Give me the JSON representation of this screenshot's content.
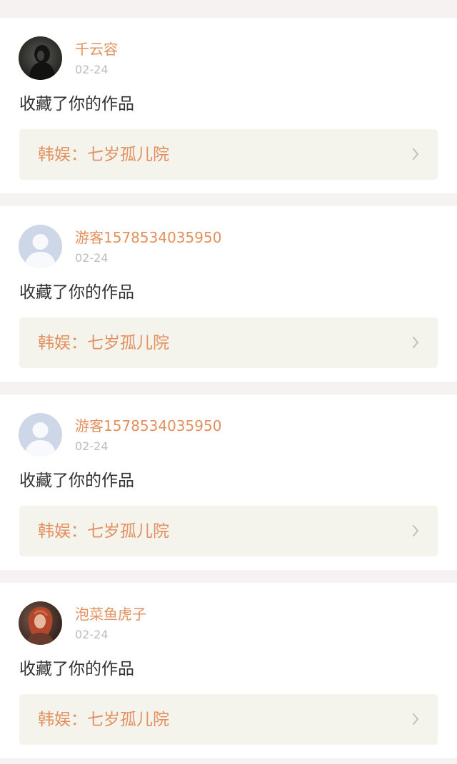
{
  "notifications": [
    {
      "username": "千云容",
      "date": "02-24",
      "action": "收藏了你的作品",
      "work_title": "韩娱：七岁孤儿院",
      "avatar": "dark-portrait"
    },
    {
      "username": "游客1578534035950",
      "date": "02-24",
      "action": "收藏了你的作品",
      "work_title": "韩娱：七岁孤儿院",
      "avatar": "default-user"
    },
    {
      "username": "游客1578534035950",
      "date": "02-24",
      "action": "收藏了你的作品",
      "work_title": "韩娱：七岁孤儿院",
      "avatar": "default-user"
    },
    {
      "username": "泡菜鱼虎子",
      "date": "02-24",
      "action": "收藏了你的作品",
      "work_title": "韩娱：七岁孤儿院",
      "avatar": "red-haired-portrait"
    }
  ],
  "colors": {
    "accent": "#e3905f",
    "date": "#bdbdbd",
    "text": "#333333",
    "link_bg": "#f4f3ec",
    "page_bg": "#f6f2f1"
  },
  "icons": {
    "chevron": "chevron-right-icon",
    "default_avatar": "default-user-avatar-icon"
  }
}
